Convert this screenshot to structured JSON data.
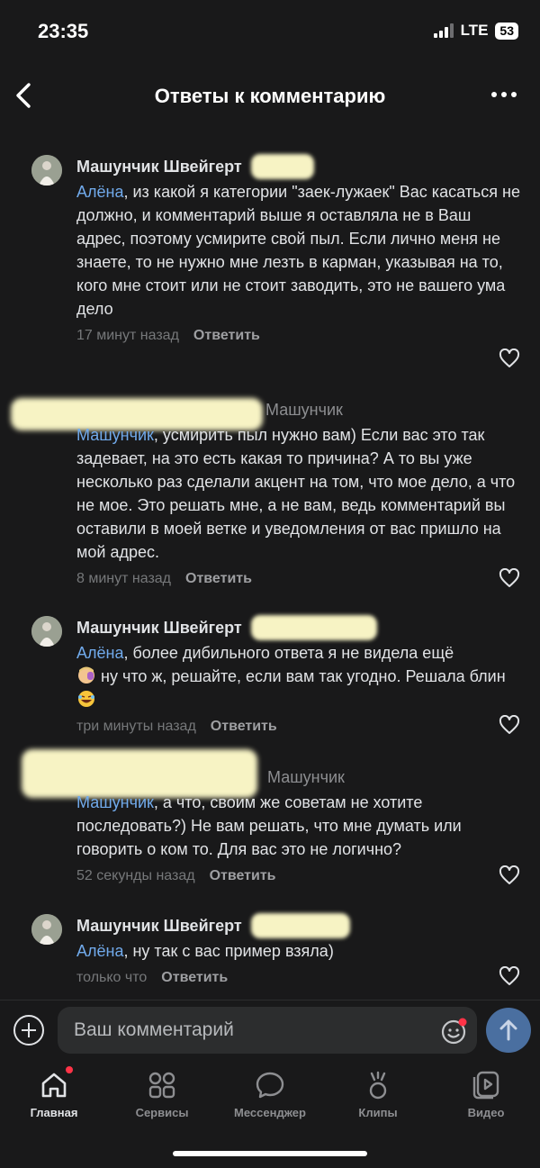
{
  "status_bar": {
    "time": "23:35",
    "network": "LTE",
    "battery": "53"
  },
  "header": {
    "title": "Ответы к комментарию"
  },
  "comments": [
    {
      "author": "Машунчик Швейгерт",
      "mention": "Алёна",
      "text": ", из какой я категории \"заек-лужаек\" Вас касаться не должно, и комментарий выше я оставляла не в Ваш адрес, поэтому усмирите свой пыл.  Если лично меня не знаете, то не нужно мне лезть в карман, указывая на то, кого мне стоит или не стоит заводить, это не вашего ума дело",
      "time": "17 минут назад",
      "reply": "Ответить"
    },
    {
      "reply_to": "Машунчик",
      "mention": "Машунчик",
      "text": ", усмирить пыл нужно вам) Если вас это так задевает, на это есть какая то причина? А то вы уже несколько раз сделали акцент на том, что мое дело, а что не мое. Это решать мне, а не вам, ведь комментарий вы оставили в моей ветке и уведомления от вас пришло на мой адрес.",
      "time": "8 минут назад",
      "reply": "Ответить"
    },
    {
      "author": "Машунчик Швейгерт",
      "mention": "Алёна",
      "text_a": ", более дибильного ответа я не видела ещё",
      "text_b": " ну что ж, решайте, если вам так угодно. Решала блин",
      "time": "три минуты назад",
      "reply": "Ответить"
    },
    {
      "reply_to": "Машунчик",
      "mention": "Машунчик",
      "text": ", а что, своим же советам не хотите последовать?) Не вам решать, что мне думать или говорить о ком то. Для вас это не логично?",
      "time": "52 секунды назад",
      "reply": "Ответить"
    },
    {
      "author": "Машунчик Швейгерт",
      "mention": "Алёна",
      "text": ", ну так с вас пример взяла)",
      "time": "только что",
      "reply": "Ответить"
    }
  ],
  "composer": {
    "placeholder": "Ваш комментарий"
  },
  "tabs": [
    {
      "label": "Главная",
      "icon": "home-icon",
      "active": true
    },
    {
      "label": "Сервисы",
      "icon": "services-icon"
    },
    {
      "label": "Мессенджер",
      "icon": "messenger-icon"
    },
    {
      "label": "Клипы",
      "icon": "clips-icon"
    },
    {
      "label": "Видео",
      "icon": "video-icon"
    }
  ],
  "colors": {
    "background": "#19191a",
    "mention": "#71aaeb",
    "accent": "#4a6fa0",
    "badge": "#ff3347"
  }
}
